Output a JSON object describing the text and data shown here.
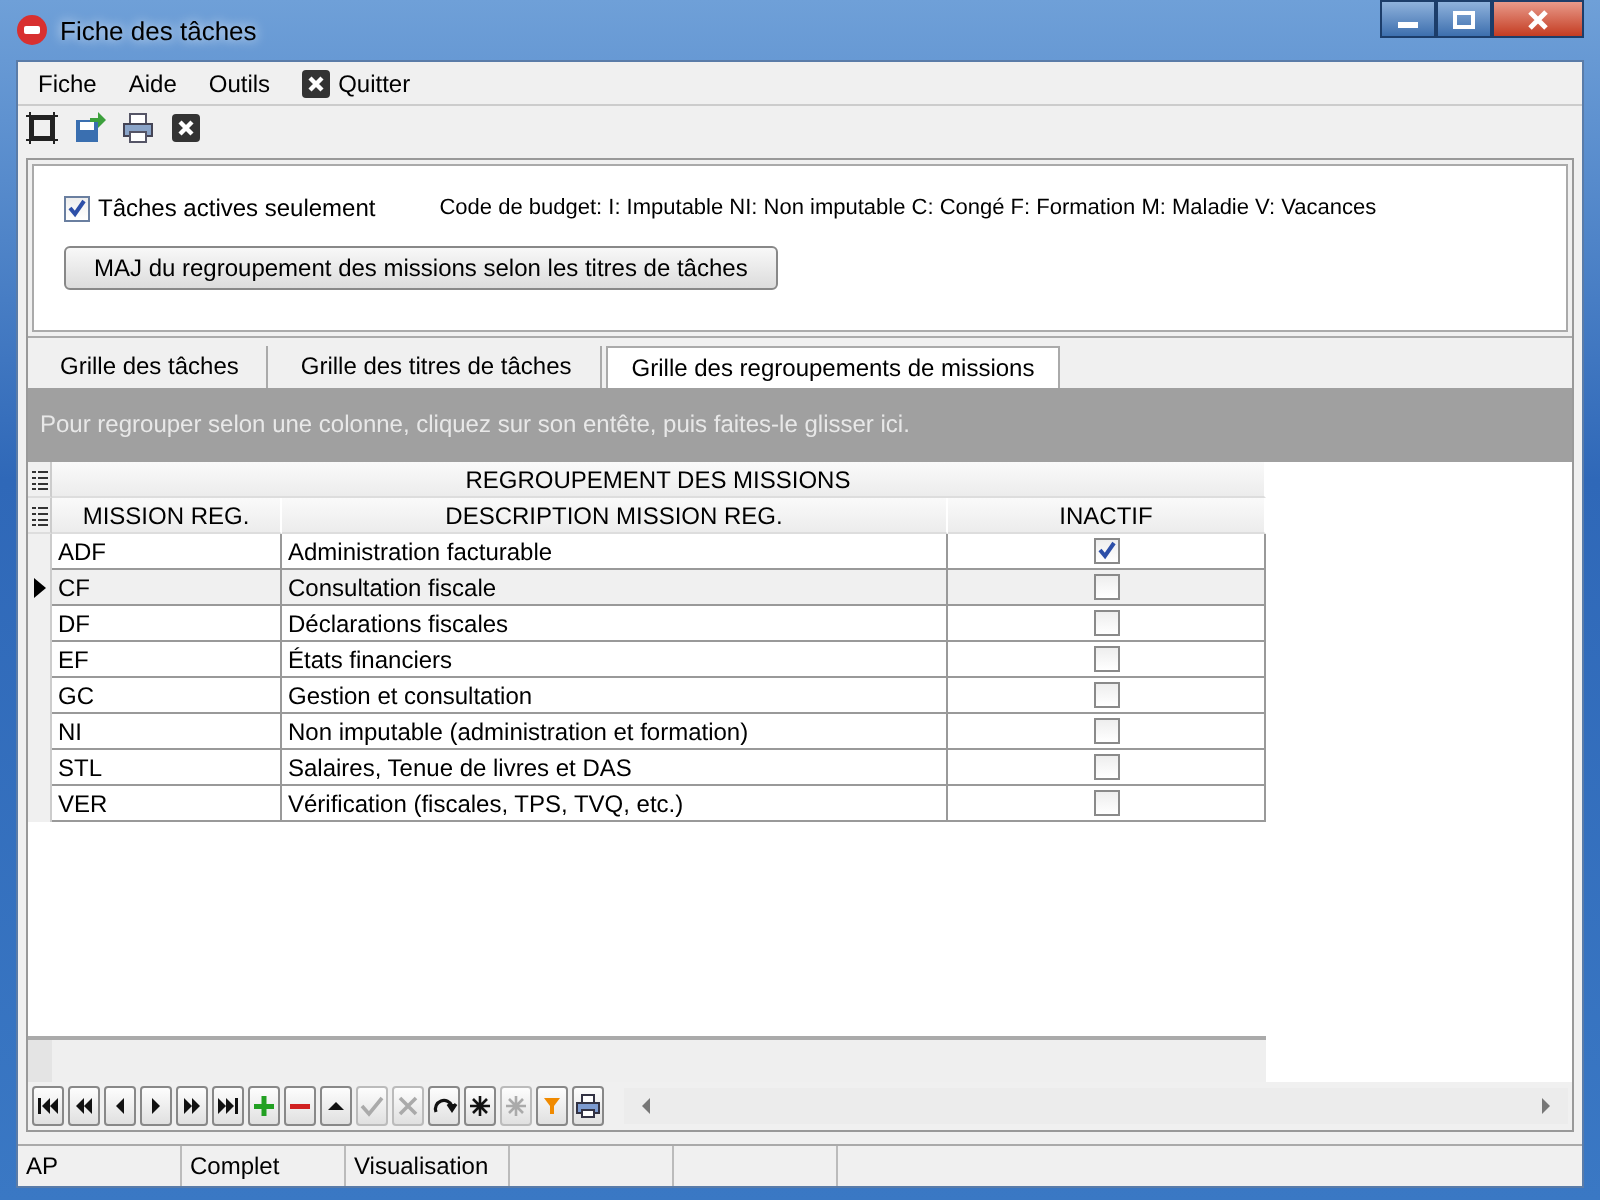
{
  "window": {
    "title": "Fiche des tâches"
  },
  "menu": [
    {
      "label": "Fiche",
      "kind": "text"
    },
    {
      "label": "Aide",
      "kind": "text"
    },
    {
      "label": "Outils",
      "kind": "text"
    },
    {
      "label": "Quitter",
      "kind": "close"
    }
  ],
  "toolbar": [
    {
      "kind": "frame"
    },
    {
      "kind": "export"
    },
    {
      "kind": "print"
    },
    {
      "kind": "close"
    }
  ],
  "options": {
    "active_only": {
      "label": "Tâches actives seulement",
      "checked": true
    },
    "budget_legend": "Code de budget: I: Imputable  NI: Non imputable C: Congé  F: Formation  M: Maladie V: Vacances",
    "update_button": "MAJ du regroupement des missions selon les titres de tâches"
  },
  "tabs": [
    {
      "label": "Grille des tâches",
      "selected": false
    },
    {
      "label": "Grille des titres de tâches",
      "selected": false
    },
    {
      "label": "Grille des regroupements de missions",
      "selected": true
    }
  ],
  "group_panel": {
    "hint": "Pour regrouper selon une colonne, cliquez sur son entête, puis faites-le glisser ici."
  },
  "grid": {
    "band": "REGROUPEMENT DES MISSIONS",
    "columns": [
      "MISSION REG.",
      "DESCRIPTION MISSION REG.",
      "INACTIF"
    ],
    "rows": [
      {
        "code": "ADF",
        "description": "Administration facturable",
        "inactive": true,
        "selected": false
      },
      {
        "code": "CF",
        "description": "Consultation fiscale",
        "inactive": false,
        "selected": true
      },
      {
        "code": "DF",
        "description": "Déclarations fiscales",
        "inactive": false,
        "selected": false
      },
      {
        "code": "EF",
        "description": "États financiers",
        "inactive": false,
        "selected": false
      },
      {
        "code": "GC",
        "description": "Gestion et consultation",
        "inactive": false,
        "selected": false
      },
      {
        "code": "NI",
        "description": "Non imputable (administration et formation)",
        "inactive": false,
        "selected": false
      },
      {
        "code": "STL",
        "description": "Salaires, Tenue de livres et DAS",
        "inactive": false,
        "selected": false
      },
      {
        "code": "VER",
        "description": "Vérification (fiscales, TPS, TVQ, etc.)",
        "inactive": false,
        "selected": false
      }
    ]
  },
  "navigator": [
    {
      "kind": "first",
      "disabled": false
    },
    {
      "kind": "prev-page",
      "disabled": false
    },
    {
      "kind": "prev",
      "disabled": false
    },
    {
      "kind": "next",
      "disabled": false
    },
    {
      "kind": "next-page",
      "disabled": false
    },
    {
      "kind": "last",
      "disabled": false
    },
    {
      "kind": "add",
      "disabled": false
    },
    {
      "kind": "delete",
      "disabled": false
    },
    {
      "kind": "edit",
      "disabled": false
    },
    {
      "kind": "post",
      "disabled": true
    },
    {
      "kind": "cancel",
      "disabled": true
    },
    {
      "kind": "refresh",
      "disabled": false
    },
    {
      "kind": "bookmark",
      "disabled": false
    },
    {
      "kind": "goto-bookmark",
      "disabled": true
    },
    {
      "kind": "filter",
      "disabled": false
    },
    {
      "kind": "print",
      "disabled": false
    }
  ],
  "status_bar": [
    "AP",
    "Complet",
    "Visualisation"
  ]
}
